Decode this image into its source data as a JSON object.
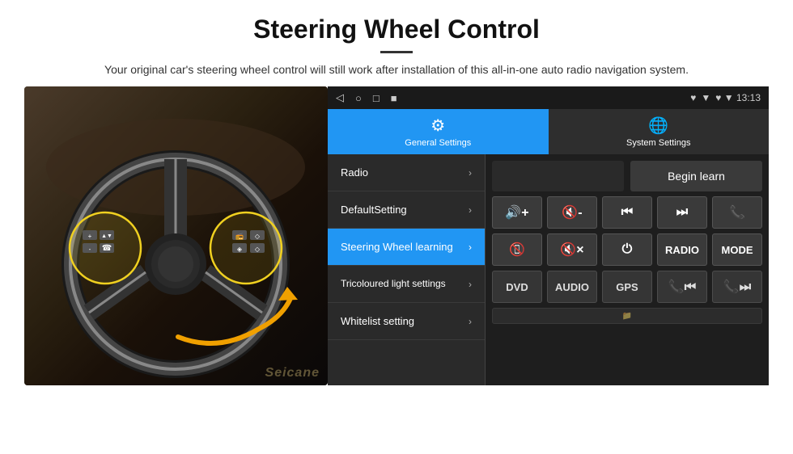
{
  "header": {
    "title": "Steering Wheel Control",
    "divider": true,
    "subtitle": "Your original car's steering wheel control will still work after installation of this all-in-one auto radio navigation system."
  },
  "tabs": [
    {
      "id": "general",
      "label": "General Settings",
      "icon": "⚙",
      "active": true
    },
    {
      "id": "system",
      "label": "System Settings",
      "icon": "🌐",
      "active": false
    }
  ],
  "status_bar": {
    "left_icons": [
      "◁",
      "○",
      "□",
      "■"
    ],
    "right": "♥ ▼ 13:13"
  },
  "menu_items": [
    {
      "id": "radio",
      "label": "Radio",
      "active": false
    },
    {
      "id": "default",
      "label": "DefaultSetting",
      "active": false
    },
    {
      "id": "steering",
      "label": "Steering Wheel learning",
      "active": true
    },
    {
      "id": "tricolour",
      "label": "Tricoloured light settings",
      "active": false
    },
    {
      "id": "whitelist",
      "label": "Whitelist setting",
      "active": false
    }
  ],
  "control_panel": {
    "begin_learn_label": "Begin learn",
    "row1": [
      {
        "id": "vol-up",
        "label": "🔊+"
      },
      {
        "id": "vol-down",
        "label": "🔇-"
      },
      {
        "id": "prev",
        "label": "⏮"
      },
      {
        "id": "next",
        "label": "⏭"
      },
      {
        "id": "phone",
        "label": "📞"
      }
    ],
    "row2": [
      {
        "id": "hang-up",
        "label": "📞↩"
      },
      {
        "id": "mute",
        "label": "🔇x"
      },
      {
        "id": "power",
        "label": "⏻"
      },
      {
        "id": "radio-btn",
        "label": "RADIO"
      },
      {
        "id": "mode",
        "label": "MODE"
      }
    ],
    "row3": [
      {
        "id": "dvd",
        "label": "DVD"
      },
      {
        "id": "audio",
        "label": "AUDIO"
      },
      {
        "id": "gps",
        "label": "GPS"
      },
      {
        "id": "tel-prev",
        "label": "📞⏮"
      },
      {
        "id": "tel-next",
        "label": "📞⏭"
      }
    ]
  },
  "watermark": "Seicane"
}
